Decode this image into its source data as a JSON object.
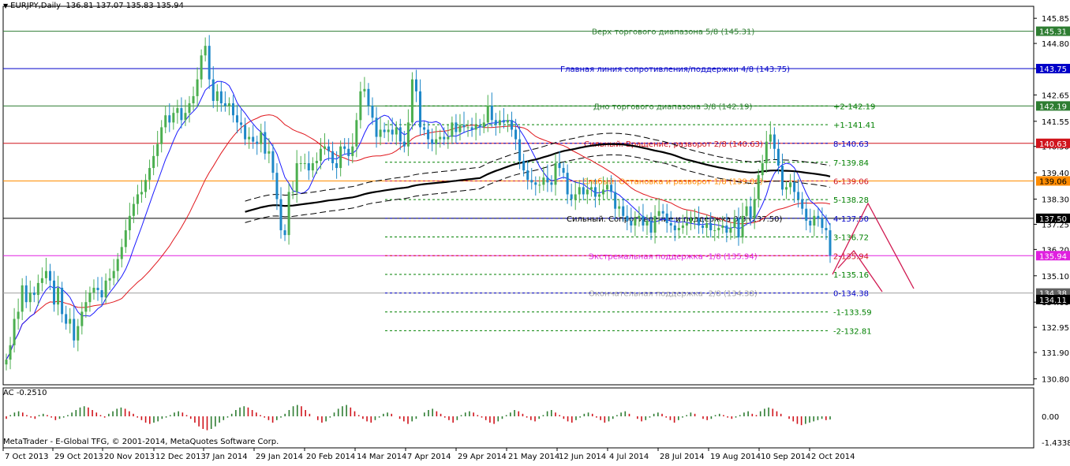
{
  "header": {
    "symbol": "EURJPY,Daily",
    "ohlc": "136.81 137.07 135.83 135.94"
  },
  "indicator": {
    "label": "AC -0.2510"
  },
  "copyright": "MetaTrader - E-Global TFG, © 2001-2014, MetaQuotes Software Corp.",
  "colors": {
    "bull": "#4caf50",
    "bear": "#1e88c8",
    "ma_fast": "#1a1aff",
    "ma_slow": "#e0161c",
    "ma_long": "#000000"
  },
  "chart_data": {
    "type": "candlestick",
    "price_axis": {
      "ylim": [
        130.55,
        146.35
      ],
      "ticks": [
        "145.85",
        "144.80",
        "143.75",
        "142.65",
        "141.55",
        "140.50",
        "139.40",
        "138.30",
        "137.25",
        "136.20",
        "135.10",
        "134.00",
        "132.95",
        "131.90",
        "130.80"
      ],
      "tick_values": [
        145.85,
        144.8,
        143.75,
        142.65,
        141.55,
        140.5,
        139.4,
        138.3,
        137.25,
        136.2,
        135.1,
        134.0,
        132.95,
        131.9,
        130.8
      ]
    },
    "date_axis": {
      "ticks": [
        "7 Oct 2013",
        "29 Oct 2013",
        "20 Nov 2013",
        "12 Dec 2013",
        "7 Jan 2014",
        "29 Jan 2014",
        "20 Feb 2014",
        "14 Mar 2014",
        "7 Apr 2014",
        "29 Apr 2014",
        "21 May 2014",
        "12 Jun 2014",
        "4 Jul 2014",
        "28 Jul 2014",
        "19 Aug 2014",
        "10 Sep 2014",
        "2 Oct 2014"
      ]
    },
    "price_tags": [
      {
        "label": "145.31",
        "value": 145.31,
        "color": "#2e7d32"
      },
      {
        "label": "143.75",
        "value": 143.75,
        "color": "#0000c8"
      },
      {
        "label": "142.19",
        "value": 142.19,
        "color": "#2e7d32"
      },
      {
        "label": "140.63",
        "value": 140.63,
        "color": "#d0141c"
      },
      {
        "label": "139.06",
        "value": 139.06,
        "color": "#ff8c00"
      },
      {
        "label": "137.50",
        "value": 137.5,
        "color": "#000000"
      },
      {
        "label": "135.94",
        "value": 135.94,
        "color": "#e020e0"
      },
      {
        "label": "134.38",
        "value": 134.38,
        "color": "#606060"
      },
      {
        "label": "134.11",
        "value": 134.11,
        "color": "#000000"
      }
    ],
    "murrey_levels": [
      {
        "text": "Верх торгового диапазона 5/8  (145.31)",
        "value": 145.31,
        "color": "#2e7d32"
      },
      {
        "text": "Главная линия сопротивления/поддержки 4/8  (143.75)",
        "value": 143.75,
        "color": "#0000c8"
      },
      {
        "text": "Дно торгового диапазона 3/8  (142.19)",
        "value": 142.19,
        "color": "#2e7d32"
      },
      {
        "text": "Сильный. Вращение, разворот 2/8  (140.63)",
        "value": 140.63,
        "color": "#d0141c"
      },
      {
        "text": "Слабый. Остановка и разворот 1/8  (139.06)",
        "value": 139.06,
        "color": "#ff8c00"
      },
      {
        "text": "Сильный. Сопротивление и поддержка 0/8  (137.50)",
        "value": 137.5,
        "color": "#000000"
      },
      {
        "text": "Экстремальная поддержка -1/8  (135.94)",
        "value": 135.94,
        "color": "#e020e0"
      },
      {
        "text": "Окончательная поддержка -2/8  (134.38)",
        "value": 134.38,
        "color": "#a0a0a0"
      }
    ],
    "grid_labels": [
      {
        "text": "+2-142.19",
        "value": 142.19,
        "color": "#008000"
      },
      {
        "text": "+1-141.41",
        "value": 141.41,
        "color": "#008000"
      },
      {
        "text": "8-140.63",
        "value": 140.63,
        "color": "#0000c8"
      },
      {
        "text": "7-139.84",
        "value": 139.84,
        "color": "#008000"
      },
      {
        "text": "6-139.06",
        "value": 139.06,
        "color": "#d0141c"
      },
      {
        "text": "5-138.28",
        "value": 138.28,
        "color": "#008000"
      },
      {
        "text": "4-137.50",
        "value": 137.5,
        "color": "#0000c8"
      },
      {
        "text": "3-136.72",
        "value": 136.72,
        "color": "#008000"
      },
      {
        "text": "2-135.94",
        "value": 135.94,
        "color": "#d0141c"
      },
      {
        "text": "1-135.16",
        "value": 135.16,
        "color": "#008000"
      },
      {
        "text": "0-134.38",
        "value": 134.38,
        "color": "#0000c8"
      },
      {
        "text": "-1-133.59",
        "value": 133.59,
        "color": "#008000"
      },
      {
        "text": "-2-132.81",
        "value": 132.81,
        "color": "#008000"
      }
    ],
    "indicator_axis": {
      "ticks": [
        "0.00",
        "-1.4338"
      ]
    },
    "series_close": [
      131.6,
      132.2,
      133.3,
      133.6,
      134.7,
      134.0,
      134.4,
      134.3,
      134.8,
      135.0,
      135.3,
      134.9,
      133.9,
      134.6,
      133.5,
      133.1,
      133.3,
      132.4,
      133.0,
      133.6,
      134.0,
      134.4,
      134.6,
      134.5,
      134.2,
      134.9,
      135.0,
      135.3,
      135.8,
      136.3,
      137.0,
      137.6,
      138.1,
      138.5,
      138.6,
      139.1,
      139.6,
      140.1,
      140.6,
      141.3,
      141.8,
      141.5,
      141.9,
      142.1,
      141.6,
      141.9,
      142.3,
      142.6,
      143.3,
      144.3,
      144.7,
      143.3,
      142.4,
      142.8,
      142.3,
      142.2,
      142.3,
      141.8,
      141.5,
      141.4,
      140.8,
      140.9,
      140.7,
      140.6,
      141.1,
      140.2,
      140.3,
      139.4,
      138.3,
      137.0,
      136.8,
      138.6,
      138.6,
      139.8,
      139.8,
      139.8,
      139.5,
      139.8,
      139.9,
      140.4,
      140.5,
      140.3,
      139.8,
      139.6,
      140.5,
      140.4,
      140.1,
      140.5,
      141.6,
      142.8,
      142.9,
      142.2,
      141.7,
      140.9,
      141.2,
      141.1,
      141.2,
      141.0,
      141.3,
      140.7,
      140.5,
      141.5,
      143.3,
      142.8,
      141.3,
      141.2,
      140.8,
      140.6,
      140.8,
      140.9,
      140.8,
      140.9,
      141.5,
      141.1,
      141.4,
      141.3,
      141.3,
      141.2,
      141.4,
      141.3,
      141.5,
      142.2,
      141.6,
      141.4,
      141.6,
      141.5,
      141.6,
      141.2,
      140.8,
      139.9,
      139.5,
      139.1,
      139.0,
      138.9,
      138.9,
      139.2,
      139.0,
      138.9,
      139.8,
      139.6,
      139.4,
      138.5,
      138.3,
      138.5,
      138.8,
      138.5,
      138.7,
      138.8,
      138.4,
      138.5,
      138.7,
      138.9,
      138.6,
      137.9,
      138.0,
      137.6,
      137.4,
      137.2,
      137.5,
      137.6,
      137.2,
      137.4,
      136.9,
      137.6,
      137.8,
      137.7,
      137.3,
      137.2,
      137.0,
      137.1,
      137.2,
      137.3,
      137.5,
      137.5,
      137.2,
      137.1,
      137.3,
      137.0,
      137.0,
      137.1,
      137.2,
      136.9,
      137.1,
      137.5,
      136.7,
      137.6,
      138.0,
      137.5,
      138.3,
      139.3,
      139.8,
      140.7,
      141.0,
      140.4,
      139.7,
      138.7,
      138.8,
      139.0,
      138.6,
      138.3,
      137.9,
      137.4,
      137.2,
      137.6,
      137.5,
      137.1,
      137.0,
      135.94
    ],
    "ac_values": [
      -0.2,
      0.1,
      0.3,
      0.4,
      0.3,
      0.1,
      -0.1,
      -0.2,
      0.1,
      0.2,
      0.1,
      -0.1,
      -0.3,
      -0.2,
      -0.1,
      0.1,
      0.3,
      0.5,
      0.7,
      0.8,
      0.7,
      0.5,
      0.3,
      0.1,
      -0.1,
      0.2,
      0.4,
      0.6,
      0.7,
      0.6,
      0.4,
      0.2,
      -0.1,
      -0.3,
      -0.5,
      -0.6,
      -0.5,
      -0.4,
      -0.2,
      -0.1,
      0.1,
      0.3,
      0.4,
      0.3,
      0.1,
      -0.2,
      -0.5,
      -0.8,
      -1.0,
      -1.1,
      -1.0,
      -0.8,
      -0.5,
      -0.3,
      -0.1,
      0.2,
      0.5,
      0.7,
      0.8,
      0.7,
      0.5,
      0.3,
      0.1,
      -0.1,
      -0.3,
      -0.5,
      -0.3,
      -0.1,
      0.2,
      0.5,
      0.8,
      0.9,
      0.8,
      0.5,
      0.2,
      0.0,
      -0.3,
      -0.5,
      -0.4,
      -0.1,
      0.3,
      0.6,
      0.8,
      0.9,
      0.7,
      0.4,
      0.1,
      -0.2,
      -0.4,
      -0.5,
      -0.3,
      -0.1,
      0.2,
      0.3,
      0.2,
      0.0,
      -0.2,
      -0.4,
      -0.6,
      -0.4,
      -0.2,
      0.0,
      0.3,
      0.5,
      0.6,
      0.4,
      0.2,
      -0.1,
      -0.3,
      -0.5,
      -0.3,
      0.1,
      0.3,
      0.4,
      0.3,
      0.1,
      -0.1,
      -0.3,
      -0.5,
      -0.6,
      -0.4,
      -0.2,
      0.1,
      0.3,
      0.5,
      0.4,
      0.2,
      -0.1,
      -0.3,
      -0.4,
      -0.2,
      0.1,
      0.4,
      0.5,
      0.3,
      0.1,
      -0.2,
      -0.4,
      -0.5,
      -0.3,
      -0.1,
      0.2,
      0.3,
      0.2,
      -0.1,
      -0.3,
      -0.5,
      -0.4,
      -0.2,
      0.1,
      0.3,
      0.4,
      0.2,
      0.0,
      -0.2,
      -0.4,
      -0.3,
      -0.1,
      0.2,
      0.3,
      0.2,
      -0.1,
      -0.3,
      -0.5,
      -0.3,
      -0.1,
      0.1,
      0.3,
      0.2,
      0.0,
      -0.2,
      -0.3,
      -0.2,
      0.1,
      0.2,
      0.1,
      -0.1,
      -0.2,
      -0.1,
      0.1,
      0.3,
      0.4,
      0.2,
      0.1,
      0.4,
      0.6,
      0.7,
      0.6,
      0.4,
      0.2,
      0.0,
      -0.2,
      -0.4,
      -0.6,
      -0.7,
      -0.6,
      -0.5,
      -0.4,
      -0.3,
      -0.2,
      -0.3,
      -0.25
    ]
  }
}
